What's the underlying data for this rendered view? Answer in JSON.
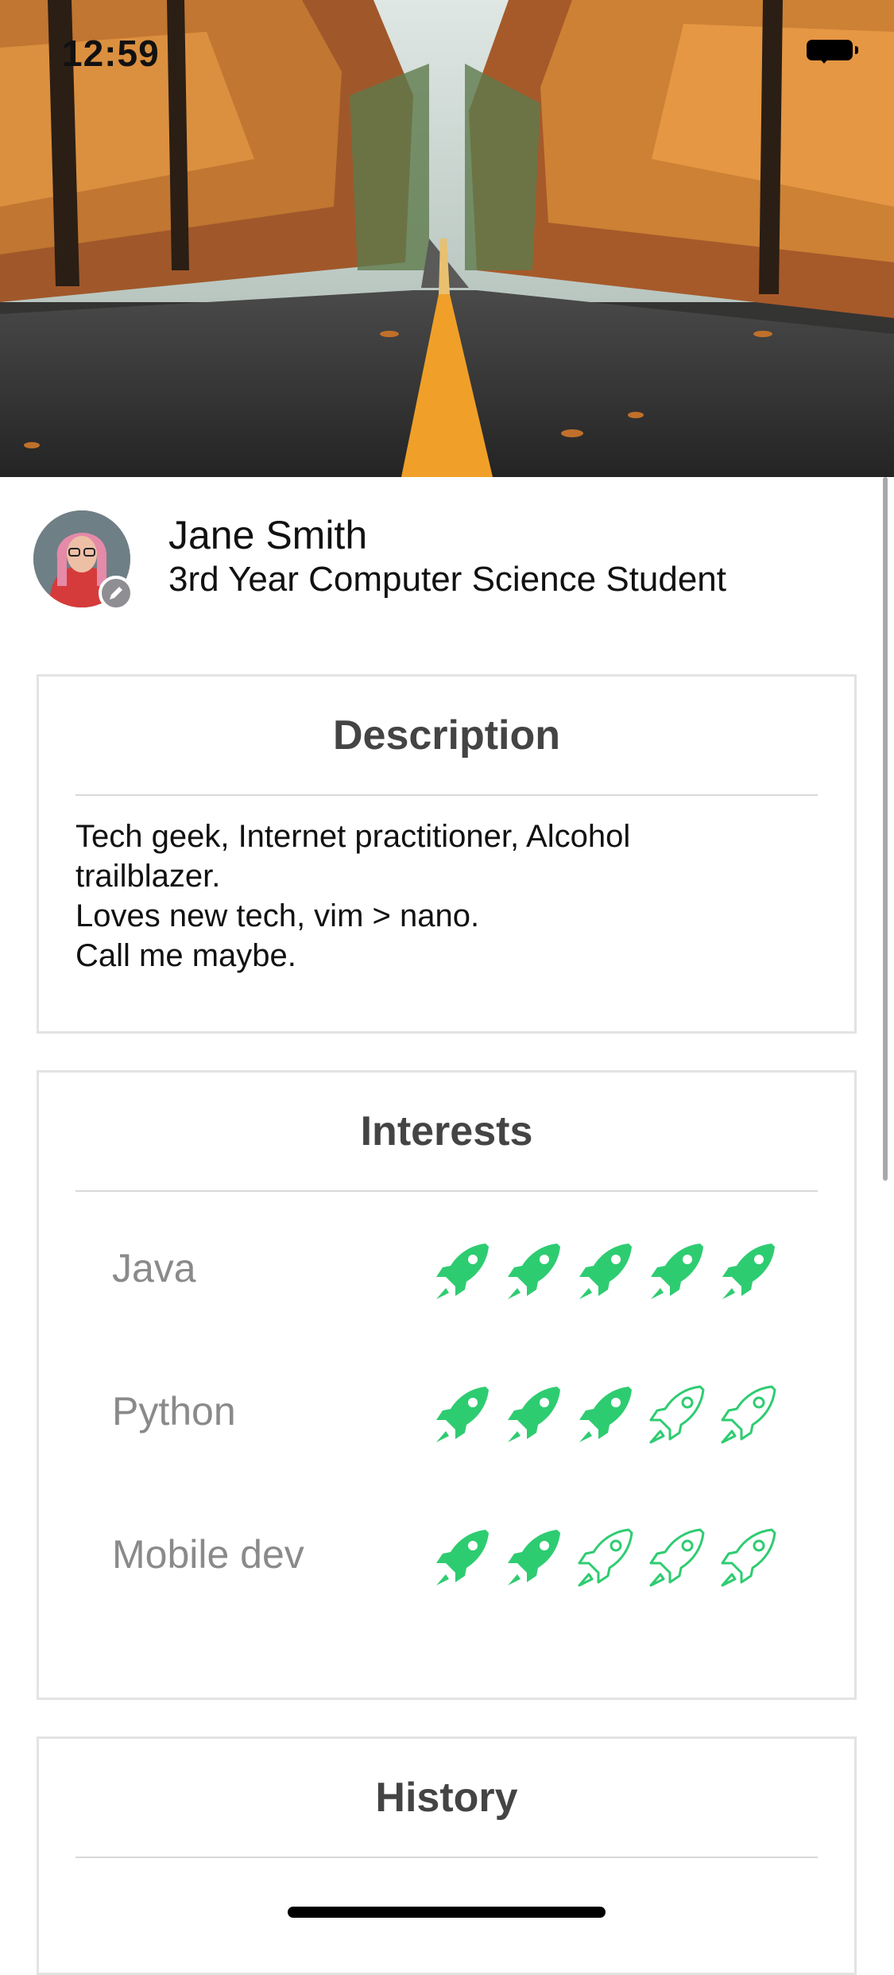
{
  "status_bar": {
    "time": "12:59"
  },
  "profile": {
    "name": "Jane Smith",
    "subtitle": "3rd Year Computer Science Student"
  },
  "description": {
    "title": "Description",
    "lines": [
      "Tech geek, Internet practitioner, Alcohol",
      "trailblazer.",
      "Loves new tech, vim > nano.",
      "Call me maybe."
    ]
  },
  "interests": {
    "title": "Interests",
    "max_rating": 5,
    "items": [
      {
        "label": "Java",
        "rating": 5
      },
      {
        "label": "Python",
        "rating": 3
      },
      {
        "label": "Mobile dev",
        "rating": 2
      }
    ]
  },
  "history": {
    "title": "History"
  },
  "colors": {
    "rocket": "#2ecc71",
    "card_border": "#e3e3e3",
    "title_text": "#444444",
    "label_text": "#8a8a8a"
  },
  "icons": [
    "wifi-icon",
    "battery-icon",
    "pencil-icon",
    "rocket-icon"
  ]
}
